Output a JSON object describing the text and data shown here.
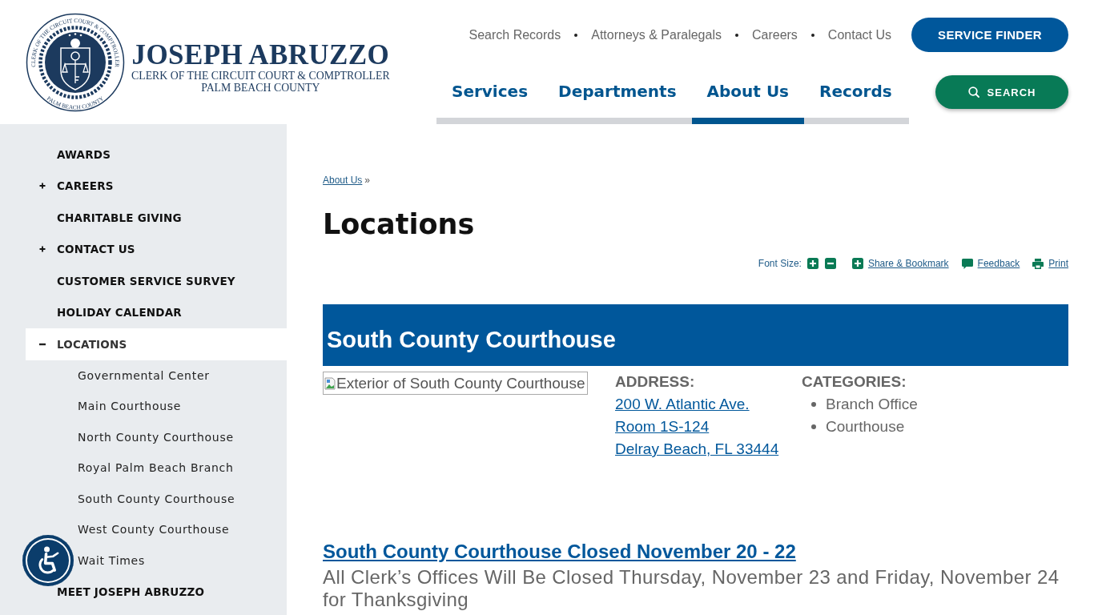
{
  "header": {
    "logo": {
      "seal_ring_top": "CLERK OF THE CIRCUIT COURT & COMPTROLLER",
      "seal_ring_bottom": "PALM BEACH COUNTY",
      "name": "JOSEPH ABRUZZO",
      "subtitle": "CLERK OF THE CIRCUIT COURT & COMPTROLLER",
      "county": "PALM BEACH COUNTY"
    },
    "utility_links": [
      "Search Records",
      "Attorneys & Paralegals",
      "Careers",
      "Contact Us"
    ],
    "service_finder_button": "SERVICE FINDER",
    "main_nav": [
      {
        "label": "Services",
        "selected": false
      },
      {
        "label": "Departments",
        "selected": false
      },
      {
        "label": "About Us",
        "selected": true
      },
      {
        "label": "Records",
        "selected": false
      }
    ],
    "search_button": "SEARCH"
  },
  "sidebar": {
    "items": [
      {
        "label": "AWARDS",
        "selected": false
      },
      {
        "label": "CAREERS",
        "selected": false,
        "expanded": false
      },
      {
        "label": "CHARITABLE GIVING",
        "selected": false
      },
      {
        "label": "CONTACT US",
        "selected": false,
        "expanded": false
      },
      {
        "label": "CUSTOMER SERVICE SURVEY",
        "selected": false
      },
      {
        "label": "HOLIDAY CALENDAR",
        "selected": false
      },
      {
        "label": "LOCATIONS",
        "selected": true,
        "expanded": true,
        "children": [
          {
            "label": "Governmental Center"
          },
          {
            "label": "Main Courthouse"
          },
          {
            "label": "North County Courthouse"
          },
          {
            "label": "Royal Palm Beach Branch"
          },
          {
            "label": "South County Courthouse"
          },
          {
            "label": "West County Courthouse"
          },
          {
            "label": "Wait Times"
          }
        ]
      },
      {
        "label": "MEET JOSEPH ABRUZZO",
        "selected": false
      }
    ]
  },
  "breadcrumb": {
    "links": [
      "About Us"
    ],
    "separator": "»"
  },
  "page_title": "Locations",
  "toolbar": {
    "font_size_label": "Font Size:",
    "actions": [
      {
        "kind": "share",
        "label": "Share & Bookmark"
      },
      {
        "kind": "feedback",
        "label": "Feedback"
      },
      {
        "kind": "print",
        "label": "Print"
      }
    ]
  },
  "location": {
    "title": "South County Courthouse",
    "image_alt": "Exterior of South County Courthouse",
    "address": {
      "label": "ADDRESS:",
      "lines": [
        "200 W. Atlantic Ave.",
        "Room 1S-124",
        "Delray Beach, FL 33444"
      ]
    },
    "categories": {
      "label": "CATEGORIES:",
      "items": [
        "Branch Office",
        "Courthouse"
      ]
    }
  },
  "news": {
    "title": "South County Courthouse Closed November 20 - 22",
    "text": "All Clerk’s Offices Will Be Closed Thursday, November 23 and Friday, November 24 for Thanksgiving"
  }
}
